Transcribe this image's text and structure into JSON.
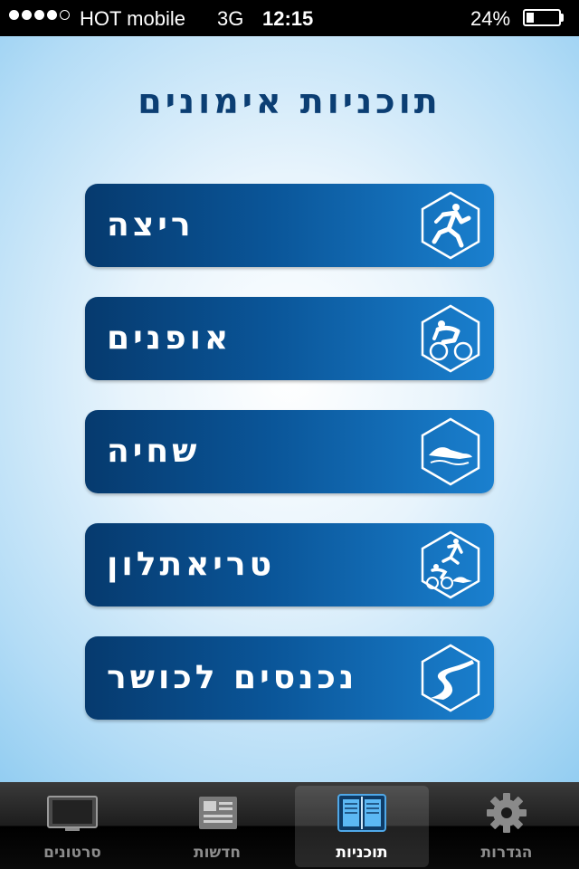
{
  "status_bar": {
    "signal_bars": 4,
    "signal_total": 5,
    "carrier": "HOT mobile",
    "network": "3G",
    "time": "12:15",
    "battery_percent": "24%",
    "battery_level": 0.24
  },
  "main": {
    "title": "תוכניות אימונים",
    "menu_items": [
      {
        "label": "ריצה",
        "icon": "running-icon"
      },
      {
        "label": "אופנים",
        "icon": "cycling-icon"
      },
      {
        "label": "שחיה",
        "icon": "swimming-icon"
      },
      {
        "label": "טריאתלון",
        "icon": "triathlon-icon"
      },
      {
        "label": "נכנסים לכושר",
        "icon": "road-icon"
      }
    ]
  },
  "tab_bar": {
    "active_tab": "תוכניות",
    "tabs": [
      {
        "label": "סרטונים",
        "icon": "tv-icon"
      },
      {
        "label": "חדשות",
        "icon": "newspaper-icon"
      },
      {
        "label": "תוכניות",
        "icon": "book-icon"
      },
      {
        "label": "הגדרות",
        "icon": "gear-icon"
      }
    ]
  },
  "colors": {
    "title": "#0b3e73",
    "button_dark": "#063a6e",
    "button_light": "#1a80cf",
    "background_center": "#ffffff",
    "background_edge": "#8ccaf0"
  }
}
